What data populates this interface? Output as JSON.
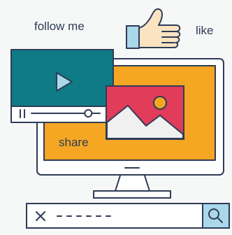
{
  "labels": {
    "follow": "follow me",
    "like": "like",
    "share": "share"
  },
  "icons": {
    "thumbs_up": "thumbs-up-icon",
    "video_player": "video-player-icon",
    "image": "image-icon",
    "monitor": "monitor-icon",
    "search": "search-icon",
    "clear": "close-icon"
  },
  "player": {
    "progress": 0.83
  },
  "colors": {
    "outline": "#2f3c56",
    "monitor_screen": "#f5a623",
    "player_screen": "#0f7b86",
    "play_icon": "#a9d8ea",
    "image_frame": "#e13c5a",
    "thumb_skin": "#fbe3c2",
    "cuff": "#a9d8ea",
    "search_button": "#a9d8ea"
  }
}
